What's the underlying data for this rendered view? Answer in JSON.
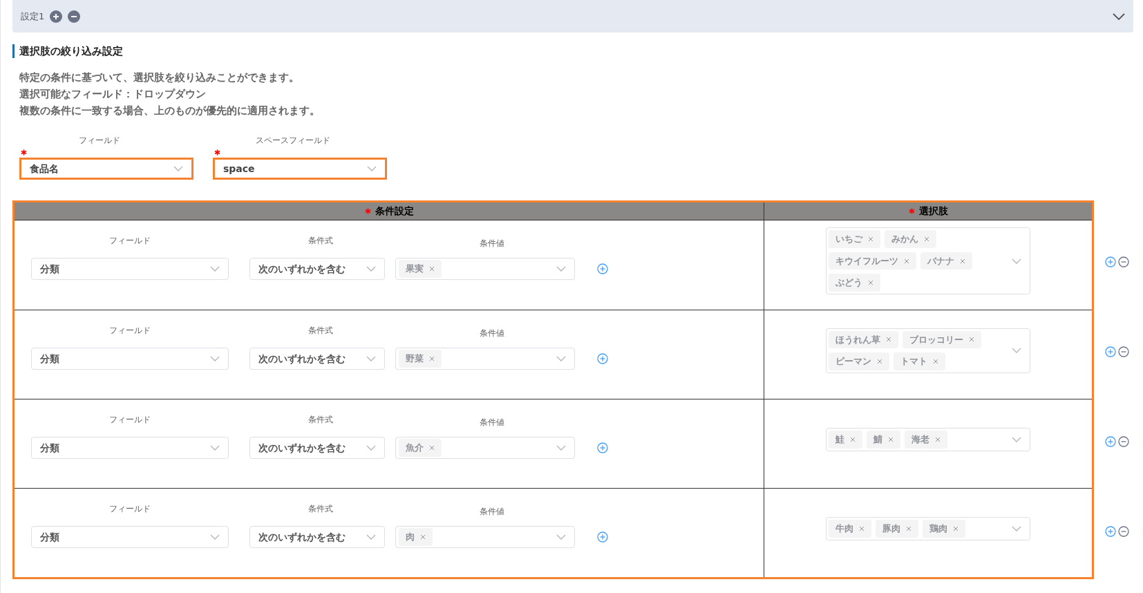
{
  "section": {
    "title": "設定1"
  },
  "heading": "選択肢の絞り込み設定",
  "description": [
    "特定の条件に基づいて、選択肢を絞り込みことができます。",
    "選択可能なフィールド：ドロップダウン",
    "複数の条件に一致する場合、上のものが優先的に適用されます。"
  ],
  "top_fields": [
    {
      "label": "フィールド",
      "required": true,
      "value": "食品名"
    },
    {
      "label": "スペースフィールド",
      "required": true,
      "value": "space"
    }
  ],
  "table": {
    "columns": [
      {
        "label": "条件設定",
        "required": true
      },
      {
        "label": "選択肢",
        "required": true
      }
    ],
    "rows": [
      {
        "field": {
          "label": "フィールド",
          "value": "分類"
        },
        "operator": {
          "label": "条件式",
          "value": "次のいずれかを含む"
        },
        "condition_value": {
          "label": "条件値",
          "tags": [
            "果実"
          ]
        },
        "choices": [
          "いちご",
          "みかん",
          "キウイフルーツ",
          "バナナ",
          "ぶどう"
        ]
      },
      {
        "field": {
          "label": "フィールド",
          "value": "分類"
        },
        "operator": {
          "label": "条件式",
          "value": "次のいずれかを含む"
        },
        "condition_value": {
          "label": "条件値",
          "tags": [
            "野菜"
          ]
        },
        "choices": [
          "ほうれん草",
          "ブロッコリー",
          "ピーマン",
          "トマト"
        ]
      },
      {
        "field": {
          "label": "フィールド",
          "value": "分類"
        },
        "operator": {
          "label": "条件式",
          "value": "次のいずれかを含む"
        },
        "condition_value": {
          "label": "条件値",
          "tags": [
            "魚介"
          ]
        },
        "choices": [
          "鮭",
          "鯖",
          "海老"
        ]
      },
      {
        "field": {
          "label": "フィールド",
          "value": "分類"
        },
        "operator": {
          "label": "条件式",
          "value": "次のいずれかを含む"
        },
        "condition_value": {
          "label": "条件値",
          "tags": [
            "肉"
          ]
        },
        "choices": [
          "牛肉",
          "豚肉",
          "鶏肉"
        ]
      }
    ]
  }
}
